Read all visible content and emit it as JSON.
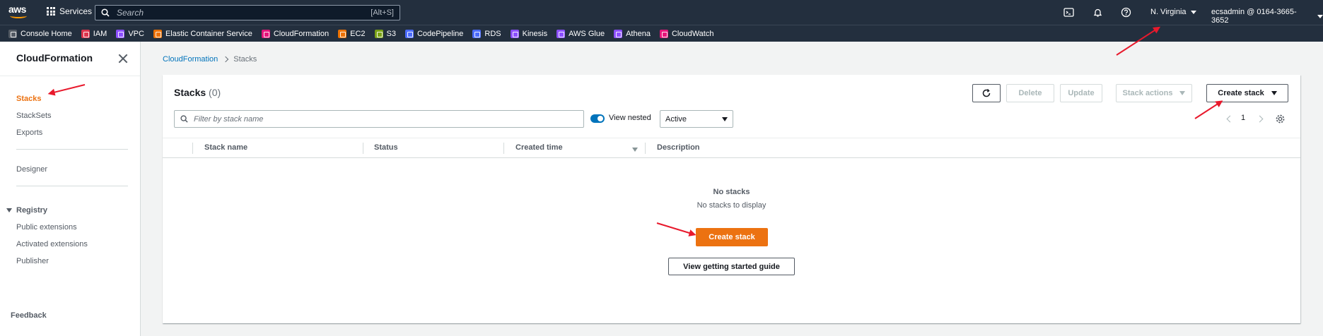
{
  "topnav": {
    "logo_text": "aws",
    "services_label": "Services",
    "search_placeholder": "Search",
    "search_shortcut": "[Alt+S]",
    "region": "N. Virginia",
    "account": "ecsadmin @ 0164-3665-3652"
  },
  "favorites": [
    {
      "label": "Console Home",
      "color": "#545b64"
    },
    {
      "label": "IAM",
      "color": "#dd344c"
    },
    {
      "label": "VPC",
      "color": "#8c4fff"
    },
    {
      "label": "Elastic Container Service",
      "color": "#ed7100"
    },
    {
      "label": "CloudFormation",
      "color": "#e7157b"
    },
    {
      "label": "EC2",
      "color": "#ed7100"
    },
    {
      "label": "S3",
      "color": "#7aa116"
    },
    {
      "label": "CodePipeline",
      "color": "#4b6bfb"
    },
    {
      "label": "RDS",
      "color": "#4b6bfb"
    },
    {
      "label": "Kinesis",
      "color": "#8c4fff"
    },
    {
      "label": "AWS Glue",
      "color": "#8c4fff"
    },
    {
      "label": "Athena",
      "color": "#8c4fff"
    },
    {
      "label": "CloudWatch",
      "color": "#e7157b"
    }
  ],
  "sidebar": {
    "title": "CloudFormation",
    "items": [
      "Stacks",
      "StackSets",
      "Exports"
    ],
    "designer": "Designer",
    "registry": "Registry",
    "registry_items": [
      "Public extensions",
      "Activated extensions",
      "Publisher"
    ],
    "feedback": "Feedback"
  },
  "breadcrumb": [
    "CloudFormation",
    "Stacks"
  ],
  "panel": {
    "title": "Stacks",
    "count": "(0)",
    "buttons": {
      "delete": "Delete",
      "update": "Update",
      "stack_actions": "Stack actions",
      "create_stack": "Create stack"
    },
    "filter_placeholder": "Filter by stack name",
    "view_nested": "View nested",
    "status_filter": "Active",
    "page": "1",
    "columns": [
      "Stack name",
      "Status",
      "Created time",
      "Description"
    ],
    "empty_title": "No stacks",
    "empty_sub": "No stacks to display",
    "empty_create": "Create stack",
    "getting_started": "View getting started guide"
  },
  "colors": {
    "nav_bg": "#232f3e",
    "accent_orange": "#ec7211",
    "link_blue": "#0073bb",
    "annotation_red": "#e8192c"
  }
}
